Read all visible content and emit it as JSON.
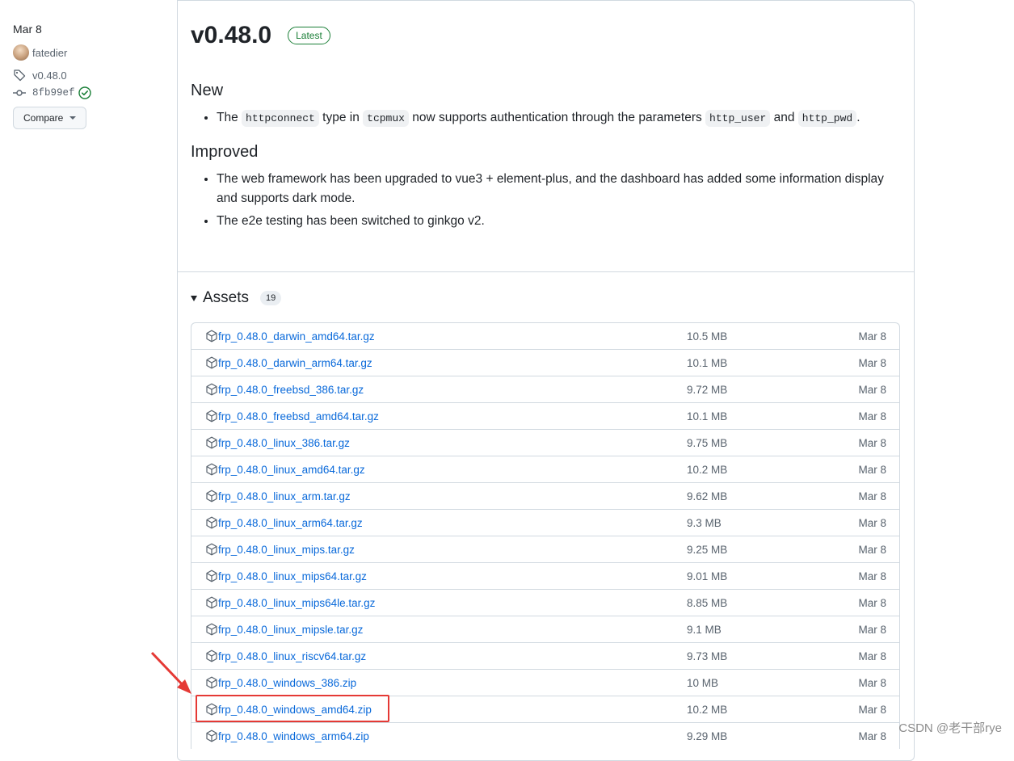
{
  "sidebar": {
    "date": "Mar 8",
    "author": "fatedier",
    "tag": "v0.48.0",
    "commit": "8fb99ef",
    "compare_label": "Compare"
  },
  "release": {
    "title": "v0.48.0",
    "badge": "Latest",
    "sections": {
      "new": {
        "heading": "New",
        "item1": {
          "t1": "The",
          "c1": "httpconnect",
          "t2": "type in",
          "c2": "tcpmux",
          "t3": "now supports authentication through the parameters",
          "c3": "http_user",
          "t4": "and",
          "c4": "http_pwd",
          "t5": "."
        }
      },
      "improved": {
        "heading": "Improved",
        "items": [
          "The web framework has been upgraded to vue3 + element-plus, and the dashboard has added some information display and supports dark mode.",
          "The e2e testing has been switched to ginkgo v2."
        ]
      }
    }
  },
  "assets": {
    "title": "Assets",
    "count": "19",
    "rows": [
      {
        "name": "frp_0.48.0_darwin_amd64.tar.gz",
        "size": "10.5 MB",
        "date": "Mar 8"
      },
      {
        "name": "frp_0.48.0_darwin_arm64.tar.gz",
        "size": "10.1 MB",
        "date": "Mar 8"
      },
      {
        "name": "frp_0.48.0_freebsd_386.tar.gz",
        "size": "9.72 MB",
        "date": "Mar 8"
      },
      {
        "name": "frp_0.48.0_freebsd_amd64.tar.gz",
        "size": "10.1 MB",
        "date": "Mar 8"
      },
      {
        "name": "frp_0.48.0_linux_386.tar.gz",
        "size": "9.75 MB",
        "date": "Mar 8"
      },
      {
        "name": "frp_0.48.0_linux_amd64.tar.gz",
        "size": "10.2 MB",
        "date": "Mar 8"
      },
      {
        "name": "frp_0.48.0_linux_arm.tar.gz",
        "size": "9.62 MB",
        "date": "Mar 8"
      },
      {
        "name": "frp_0.48.0_linux_arm64.tar.gz",
        "size": "9.3 MB",
        "date": "Mar 8"
      },
      {
        "name": "frp_0.48.0_linux_mips.tar.gz",
        "size": "9.25 MB",
        "date": "Mar 8"
      },
      {
        "name": "frp_0.48.0_linux_mips64.tar.gz",
        "size": "9.01 MB",
        "date": "Mar 8"
      },
      {
        "name": "frp_0.48.0_linux_mips64le.tar.gz",
        "size": "8.85 MB",
        "date": "Mar 8"
      },
      {
        "name": "frp_0.48.0_linux_mipsle.tar.gz",
        "size": "9.1 MB",
        "date": "Mar 8"
      },
      {
        "name": "frp_0.48.0_linux_riscv64.tar.gz",
        "size": "9.73 MB",
        "date": "Mar 8"
      },
      {
        "name": "frp_0.48.0_windows_386.zip",
        "size": "10 MB",
        "date": "Mar 8"
      },
      {
        "name": "frp_0.48.0_windows_amd64.zip",
        "size": "10.2 MB",
        "date": "Mar 8"
      },
      {
        "name": "frp_0.48.0_windows_arm64.zip",
        "size": "9.29 MB",
        "date": "Mar 8"
      }
    ]
  },
  "watermark": "CSDN @老干部rye",
  "colors": {
    "link": "#0969da",
    "latest_badge": "#1a7f37",
    "annotation": "#e53935",
    "border": "#d1d9e0"
  },
  "icons": {
    "tag": "tag-icon",
    "commit": "git-commit-icon",
    "verified": "verified-check-icon",
    "package": "package-icon",
    "caret": "triangle-down-icon"
  }
}
